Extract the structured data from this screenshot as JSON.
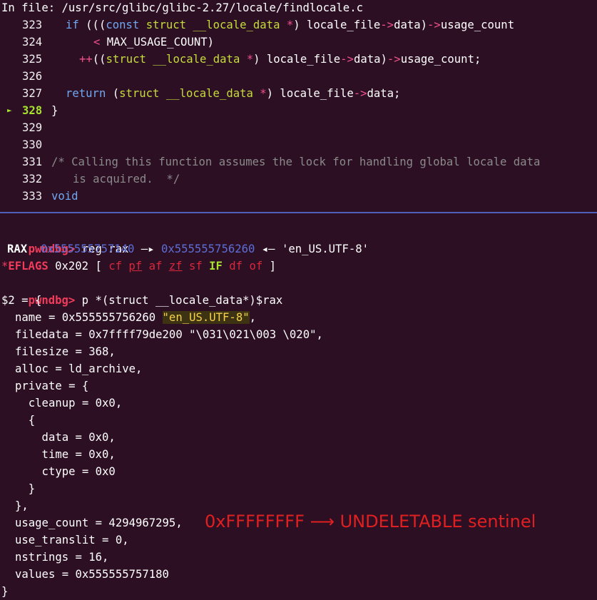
{
  "source": {
    "header": "In file: /usr/src/glibc/glibc-2.27/locale/findlocale.c",
    "current_marker": "►",
    "lines": [
      {
        "num": "323",
        "segs": [
          [
            "kw",
            "if "
          ],
          [
            "",
            "((("
          ],
          [
            "kw",
            "const "
          ],
          [
            "ty",
            "struct "
          ],
          [
            "ty",
            "__locale_data "
          ],
          [
            "op",
            "*"
          ],
          [
            "",
            ") locale_file"
          ],
          [
            "op",
            "->"
          ],
          [
            "",
            "data)"
          ],
          [
            "op",
            "->"
          ],
          [
            "",
            "usage_count"
          ]
        ]
      },
      {
        "num": "324",
        "segs": [
          [
            "op",
            "< "
          ],
          [
            "",
            "MAX_USAGE_COUNT)"
          ]
        ]
      },
      {
        "num": "325",
        "segs": [
          [
            "op",
            "++"
          ],
          [
            "",
            "(("
          ],
          [
            "ty",
            "struct "
          ],
          [
            "ty",
            "__locale_data "
          ],
          [
            "op",
            "*"
          ],
          [
            "",
            ") locale_file"
          ],
          [
            "op",
            "->"
          ],
          [
            "",
            "data)"
          ],
          [
            "op",
            "->"
          ],
          [
            "",
            "usage_count;"
          ]
        ]
      },
      {
        "num": "326",
        "segs": []
      },
      {
        "num": "327",
        "segs": [
          [
            "kw",
            "return "
          ],
          [
            "",
            "("
          ],
          [
            "ty",
            "struct "
          ],
          [
            "ty",
            "__locale_data "
          ],
          [
            "op",
            "*"
          ],
          [
            "",
            ") locale_file"
          ],
          [
            "op",
            "->"
          ],
          [
            "",
            "data;"
          ]
        ]
      },
      {
        "num": "328",
        "segs": [
          [
            "",
            "}"
          ]
        ]
      },
      {
        "num": "329",
        "segs": []
      },
      {
        "num": "330",
        "segs": []
      },
      {
        "num": "331",
        "segs": [
          [
            "cm",
            "/* Calling this function assumes the lock for handling global locale data"
          ]
        ]
      },
      {
        "num": "332",
        "segs": [
          [
            "cm",
            "is acquired.  */"
          ]
        ]
      },
      {
        "num": "333",
        "segs": [
          [
            "kw",
            "void"
          ]
        ]
      }
    ]
  },
  "terminal": {
    "prompt": "pwndbg>",
    "cmd1": "reg rax",
    "rax_label": "RAX",
    "rax_addr1": "0x555555757140",
    "arrow1": "—▸",
    "rax_addr2": "0x555555756260",
    "arrow2": "◂—",
    "rax_str": "'en_US.UTF-8'",
    "eflags_star": "*",
    "eflags_label": "EFLAGS",
    "eflags_val": "0x202",
    "bracket_open": "[",
    "bracket_close": "]",
    "flags": [
      {
        "name": "cf",
        "on": false,
        "underline": false
      },
      {
        "name": "pf",
        "on": false,
        "underline": true
      },
      {
        "name": "af",
        "on": false,
        "underline": false
      },
      {
        "name": "zf",
        "on": false,
        "underline": true
      },
      {
        "name": "sf",
        "on": false,
        "underline": false
      },
      {
        "name": "IF",
        "on": true,
        "underline": false
      },
      {
        "name": "df",
        "on": false,
        "underline": false
      },
      {
        "name": "of",
        "on": false,
        "underline": false
      }
    ],
    "cmd2": "p *(struct __locale_data*)$rax",
    "result_open": "$2 = {",
    "name_prefix": "name = 0x555555756260 ",
    "name_str": "\"en_US.UTF-8\"",
    "name_suffix": ",",
    "body": [
      "filedata = 0x7ffff79de200 \"\\031\\021\\003 \\020\",",
      "filesize = 368,",
      "alloc = ld_archive,",
      "private = {",
      "  cleanup = 0x0,",
      "  {",
      "    data = 0x0,",
      "    time = 0x0,",
      "    ctype = 0x0",
      "  }",
      "},",
      "usage_count = 4294967295,",
      "use_translit = 0,",
      "nstrings = 16,",
      "values = 0x555555757180"
    ],
    "result_close": "}"
  },
  "annotation": "0xFFFFFFFF ⟶ UNDELETABLE sentinel",
  "colors": {
    "background": "#2d0f24",
    "prompt": "#f03c5a",
    "annotation": "#e02020",
    "separator": "#5060b8"
  }
}
